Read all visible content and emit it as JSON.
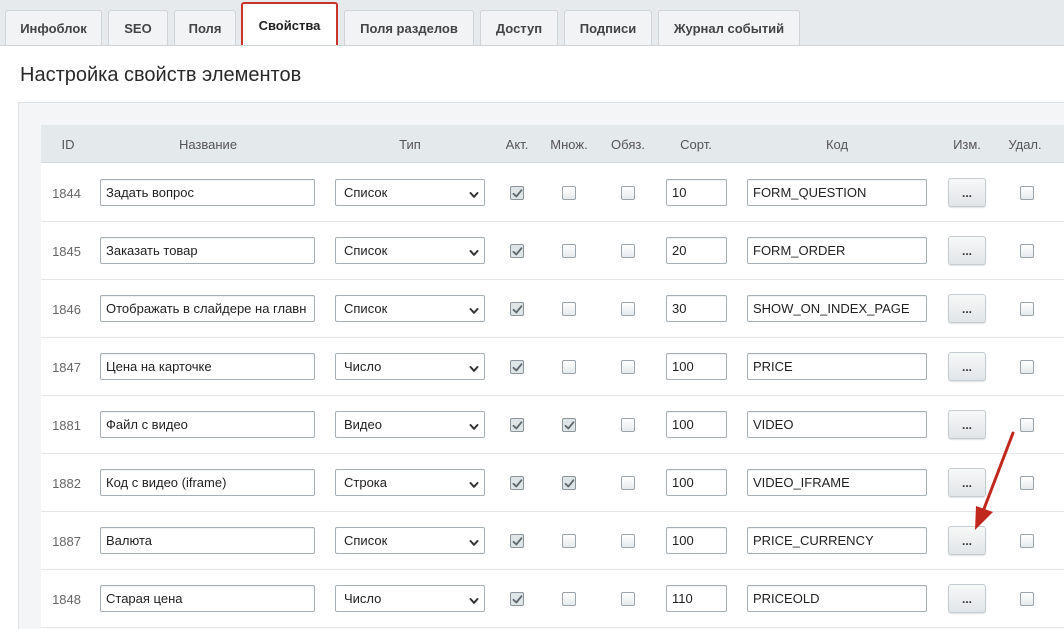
{
  "tabs": [
    {
      "label": "Инфоблок",
      "active": false
    },
    {
      "label": "SEO",
      "active": false
    },
    {
      "label": "Поля",
      "active": false
    },
    {
      "label": "Свойства",
      "active": true
    },
    {
      "label": "Поля разделов",
      "active": false
    },
    {
      "label": "Доступ",
      "active": false
    },
    {
      "label": "Подписи",
      "active": false
    },
    {
      "label": "Журнал событий",
      "active": false
    }
  ],
  "page_title": "Настройка свойств элементов",
  "columns": {
    "id": "ID",
    "name": "Название",
    "type": "Тип",
    "active": "Акт.",
    "multiple": "Множ.",
    "required": "Обяз.",
    "sort": "Сорт.",
    "code": "Код",
    "edit": "Изм.",
    "delete": "Удал."
  },
  "edit_button_label": "...",
  "rows": [
    {
      "id": "1844",
      "name": "Задать вопрос",
      "type": "Список",
      "active": true,
      "multiple": false,
      "required": false,
      "sort": "10",
      "code": "FORM_QUESTION",
      "delete": false
    },
    {
      "id": "1845",
      "name": "Заказать товар",
      "type": "Список",
      "active": true,
      "multiple": false,
      "required": false,
      "sort": "20",
      "code": "FORM_ORDER",
      "delete": false
    },
    {
      "id": "1846",
      "name": "Отображать в слайдере на главн",
      "type": "Список",
      "active": true,
      "multiple": false,
      "required": false,
      "sort": "30",
      "code": "SHOW_ON_INDEX_PAGE",
      "delete": false
    },
    {
      "id": "1847",
      "name": "Цена на карточке",
      "type": "Число",
      "active": true,
      "multiple": false,
      "required": false,
      "sort": "100",
      "code": "PRICE",
      "delete": false
    },
    {
      "id": "1881",
      "name": "Файл с видео",
      "type": "Видео",
      "active": true,
      "multiple": true,
      "required": false,
      "sort": "100",
      "code": "VIDEO",
      "delete": false
    },
    {
      "id": "1882",
      "name": "Код с видео (iframe)",
      "type": "Строка",
      "active": true,
      "multiple": true,
      "required": false,
      "sort": "100",
      "code": "VIDEO_IFRAME",
      "delete": false
    },
    {
      "id": "1887",
      "name": "Валюта",
      "type": "Список",
      "active": true,
      "multiple": false,
      "required": false,
      "sort": "100",
      "code": "PRICE_CURRENCY",
      "delete": false
    },
    {
      "id": "1848",
      "name": "Старая цена",
      "type": "Число",
      "active": true,
      "multiple": false,
      "required": false,
      "sort": "110",
      "code": "PRICEOLD",
      "delete": false
    }
  ],
  "colors": {
    "active_tab_border": "#c8342a",
    "annotation_arrow": "#c0281e",
    "header_bg": "#e4e9ec"
  }
}
